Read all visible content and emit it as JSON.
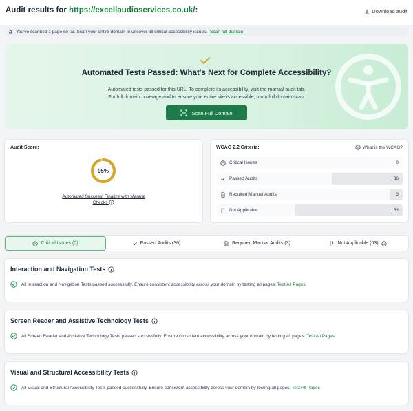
{
  "header": {
    "title_prefix": "Audit results for ",
    "url": "https://excellaudioservices.co.uk/",
    "title_suffix": ":",
    "download_label": "Download audit"
  },
  "notice": {
    "text": "You've scanned 1 page so far. Scan your entire domain to uncover all critical accessibility issues.",
    "link": "Scan full domain"
  },
  "hero": {
    "title": "Automated Tests Passed: What's Next for Complete Accessibility?",
    "line1": "Automated tests passed for this URL. To complete its accessibility, visit the manual audit tab.",
    "line2": "For full domain coverage and to ensure your entire site is accessible, run a full domain scan.",
    "button": "Scan Full Domain"
  },
  "score": {
    "label": "Audit Score:",
    "value": "95%",
    "percent": 95,
    "message_line1": "Automated Success! Finalize with Manual",
    "message_line2": "Checks",
    "ring_color": "#d4a72c"
  },
  "wcag": {
    "title": "WCAG 2.2 Criteria:",
    "link": "What is the WCAG?",
    "rows": [
      {
        "label": "Critical Issues",
        "count": "0",
        "fill": 0
      },
      {
        "label": "Passed Audits",
        "count": "36",
        "fill": 0.38
      },
      {
        "label": "Required Manual Audits",
        "count": "3",
        "fill": 0.07
      },
      {
        "label": "Not Applicable",
        "count": "53",
        "fill": 0.58
      }
    ]
  },
  "tabs": [
    {
      "label": "Critical Issues (0)"
    },
    {
      "label": "Passed Audits (36)"
    },
    {
      "label": "Required Manual Audits (3)"
    },
    {
      "label": "Not Applicable (53)"
    }
  ],
  "sections": [
    {
      "title": "Interaction and Navigation Tests",
      "text": "All Interaction and Navigation Tests passed successfully. Ensure consistent accessibility across your domain by testing all pages:",
      "link": "Test All Pages"
    },
    {
      "title": "Screen Reader and Assistive Technology Tests",
      "text": "All Screen Reader and Assistive Technology Tests passed successfully. Ensure consistent accessibility across your domain by testing all pages:",
      "link": "Test All Pages"
    },
    {
      "title": "Visual and Structural Accessibility Tests",
      "text": "All Visual and Structural Accessibility Tests passed successfully. Ensure consistent accessibility across your domain by testing all pages:",
      "link": "Test All Pages"
    }
  ],
  "colors": {
    "accent": "#15803d",
    "button": "#1f7a4a"
  }
}
